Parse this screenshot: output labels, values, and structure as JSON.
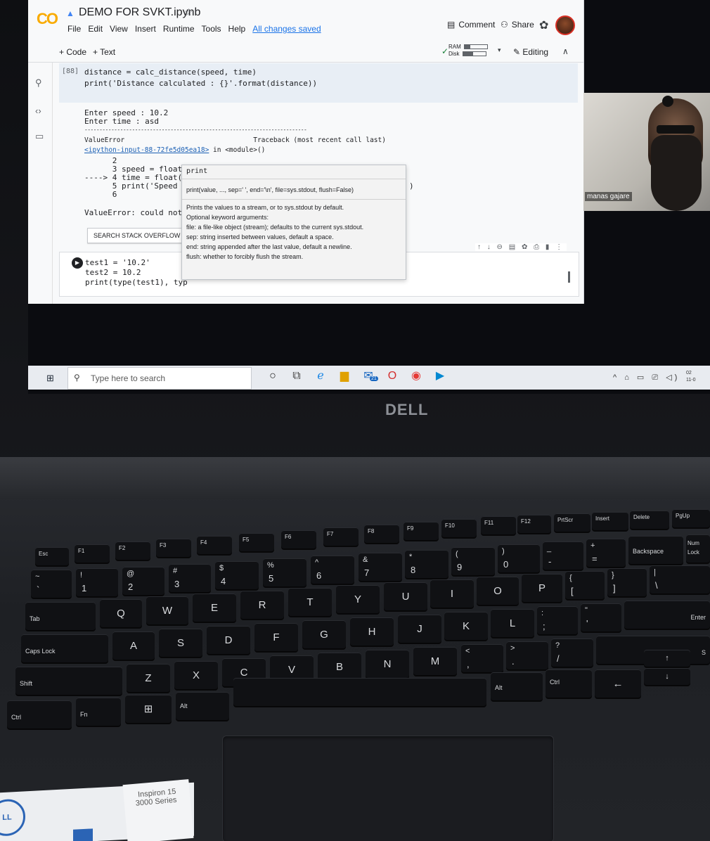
{
  "colab": {
    "logo": "CO",
    "notebook_title": "DEMO FOR SVKT.ipynb",
    "menu": [
      "File",
      "Edit",
      "View",
      "Insert",
      "Runtime",
      "Tools",
      "Help"
    ],
    "saved_status": "All changes saved",
    "comment_label": "Comment",
    "share_label": "Share",
    "add_code_label": "+ Code",
    "add_text_label": "+ Text",
    "ram_label": "RAM",
    "disk_label": "Disk",
    "ram_level": 0.25,
    "disk_level": 0.45,
    "editing_label": "Editing"
  },
  "cell1": {
    "exec_count": "[88]",
    "lines": [
      "distance = calc_distance(speed, time)",
      "print('Distance calculated : {}'.format(distance))"
    ]
  },
  "output": {
    "lines": [
      "Enter speed : 10.2",
      "Enter time : asd",
      "---------------------------------------------------------------------------",
      "ValueError                                Traceback (most recent call last)",
      "<ipython-input-88-72fe5d05ea18> in <module>()",
      "      2",
      "      3 speed = float(",
      "----> 4 time = float(i",
      "      5 print('Speed e",
      "      6",
      "ValueError: could not"
    ],
    "link_text": "<ipython-input-88-72fe5d05ea18>",
    "paren_fragment": ")",
    "so_button": "SEARCH STACK OVERFLOW"
  },
  "tooltip": {
    "title": "print",
    "signature": "print(value, ..., sep=' ', end='\\n', file=sys.stdout, flush=False)",
    "doc": [
      "Prints the values to a stream, or to sys.stdout by default.",
      "Optional keyword arguments:",
      "file:  a file-like object (stream); defaults to the current sys.stdout.",
      "sep:   string inserted between values, default a space.",
      "end:   string appended after the last value, default a newline.",
      "flush: whether to forcibly flush the stream."
    ]
  },
  "cell2": {
    "lines": [
      "test1 = '10.2'",
      "test2 = 10.2",
      "print(type(test1), typ"
    ],
    "cell_actions": "↑ ↓ ⊖ ▤ ✿ ⎙ ▮ ⋮"
  },
  "video": {
    "name": "manas gajare"
  },
  "taskbar": {
    "search_placeholder": "Type here to search",
    "mail_badge": "21",
    "clock_time": "02",
    "clock_date": "11-0"
  },
  "laptop": {
    "brand": "DELL",
    "model_line1": "Inspiron 15",
    "model_line2": "3000 Series",
    "sticker_logo": "LL"
  },
  "keyboard": {
    "fn_row": [
      "Esc",
      "F1",
      "F2",
      "F3",
      "F4",
      "F5",
      "F6",
      "F7",
      "F8",
      "F9",
      "F10",
      "F11",
      "F12",
      "PrtScr",
      "Insert",
      "Delete",
      "PgUp"
    ],
    "number_row": [
      {
        "top": "~",
        "bottom": "`"
      },
      {
        "top": "!",
        "bottom": "1"
      },
      {
        "top": "@",
        "bottom": "2"
      },
      {
        "top": "#",
        "bottom": "3"
      },
      {
        "top": "$",
        "bottom": "4"
      },
      {
        "top": "%",
        "bottom": "5"
      },
      {
        "top": "^",
        "bottom": "6"
      },
      {
        "top": "&",
        "bottom": "7"
      },
      {
        "top": "*",
        "bottom": "8"
      },
      {
        "top": "(",
        "bottom": "9"
      },
      {
        "top": ")",
        "bottom": "0"
      },
      {
        "top": "_",
        "bottom": "-"
      },
      {
        "top": "+",
        "bottom": "="
      }
    ],
    "backspace": "Backspace",
    "num_lock": "Num Lock",
    "tab": "Tab",
    "qwerty": [
      "Q",
      "W",
      "E",
      "R",
      "T",
      "Y",
      "U",
      "I",
      "O",
      "P"
    ],
    "bracket_keys": [
      {
        "top": "{",
        "bottom": "["
      },
      {
        "top": "}",
        "bottom": "]"
      },
      {
        "top": "|",
        "bottom": "\\"
      }
    ],
    "caps": "Caps Lock",
    "asdf": [
      "A",
      "S",
      "D",
      "F",
      "G",
      "H",
      "J",
      "K",
      "L"
    ],
    "home_punct": [
      {
        "top": ":",
        "bottom": ";"
      },
      {
        "top": "\"",
        "bottom": "'"
      }
    ],
    "enter": "Enter",
    "shift": "Shift",
    "zxcv": [
      "Z",
      "X",
      "C",
      "V",
      "B",
      "N",
      "M"
    ],
    "bottom_punct": [
      {
        "top": "<",
        "bottom": ","
      },
      {
        "top": ">",
        "bottom": "."
      },
      {
        "top": "?",
        "bottom": "/"
      }
    ],
    "right_shift": "S",
    "ctrl": "Ctrl",
    "fn": "Fn",
    "alt": "Alt",
    "alt_right": "Alt",
    "ctrl_right": "Ctrl"
  }
}
